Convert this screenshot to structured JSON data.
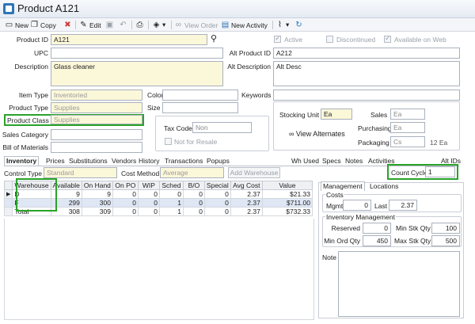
{
  "window": {
    "title": "Product A121"
  },
  "toolbar": {
    "new": "New",
    "copy": "Copy",
    "edit": "Edit",
    "view_order": "View Order",
    "new_activity": "New Activity"
  },
  "form": {
    "product_id_label": "Product ID",
    "product_id": "A121",
    "upc_label": "UPC",
    "upc": "",
    "description_label": "Description",
    "description": "Glass cleaner",
    "active_label": "Active",
    "active_checked": true,
    "discontinued_label": "Discontinued",
    "discontinued_checked": false,
    "available_web_label": "Available on Web",
    "available_web_checked": true,
    "alt_product_id_label": "Alt Product ID",
    "alt_product_id": "A212",
    "alt_description_label": "Alt Description",
    "alt_description": "Alt Desc",
    "item_type_label": "Item Type",
    "item_type": "Inventoried",
    "product_type_label": "Product Type",
    "product_type": "Supplies",
    "product_class_label": "Product Class",
    "product_class": "Supplies",
    "sales_category_label": "Sales Category",
    "sales_category": "",
    "bill_of_materials_label": "Bill of Materials",
    "bill_of_materials": "",
    "color_label": "Color",
    "color": "",
    "size_label": "Size",
    "size": "",
    "keywords_label": "Keywords",
    "keywords": "",
    "tax_code_label": "Tax Code",
    "tax_code": "Non",
    "not_for_resale_label": "Not for Resale",
    "stocking_unit_label": "Stocking Unit",
    "stocking_unit": "Ea",
    "sales_label": "Sales",
    "sales_unit": "Ea",
    "purchasing_label": "Purchasing",
    "purchasing_unit": "Ea",
    "packaging_label": "Packaging",
    "packaging_unit": "Cs",
    "packaging_qty": "12 Ea",
    "view_alternates": "View Alternates"
  },
  "tabs": [
    "Inventory",
    "Prices",
    "Substitutions",
    "Vendors",
    "History",
    "Transactions",
    "Popups"
  ],
  "right_tabs": [
    "Wh Used",
    "Specs",
    "Notes",
    "Activities",
    "Alt IDs"
  ],
  "inventory": {
    "control_type_label": "Control Type",
    "control_type": "Standard",
    "cost_method_label": "Cost Method",
    "cost_method": "Average",
    "add_warehouse": "Add Warehouse",
    "count_cycle_label": "Count Cycle",
    "count_cycle": "1",
    "columns": [
      "Warehouse",
      "Available",
      "On Hand",
      "On PO",
      "WIP",
      "Sched",
      "B/O",
      "Special",
      "Avg Cost",
      "Value"
    ],
    "rows": [
      [
        "D",
        "9",
        "9",
        "0",
        "0",
        "0",
        "0",
        "0",
        "2.37",
        "$21.33"
      ],
      [
        "F",
        "299",
        "300",
        "0",
        "0",
        "1",
        "0",
        "0",
        "2.37",
        "$711.00"
      ],
      [
        "Total",
        "308",
        "309",
        "0",
        "0",
        "1",
        "0",
        "0",
        "2.37",
        "$732.33"
      ]
    ]
  },
  "management": {
    "tab_management": "Management",
    "tab_locations": "Locations",
    "costs_label": "Costs",
    "mgmt_label": "Mgmt",
    "mgmt": "0",
    "last_label": "Last",
    "last": "2.37",
    "inv_mgmt_label": "Inventory Management",
    "reserved_label": "Reserved",
    "reserved": "0",
    "min_stk_label": "Min Stk Qty",
    "min_stk": "100",
    "min_ord_label": "Min Ord Qty",
    "min_ord": "450",
    "max_stk_label": "Max Stk Qty",
    "max_stk": "500",
    "note_label": "Note",
    "note": ""
  }
}
